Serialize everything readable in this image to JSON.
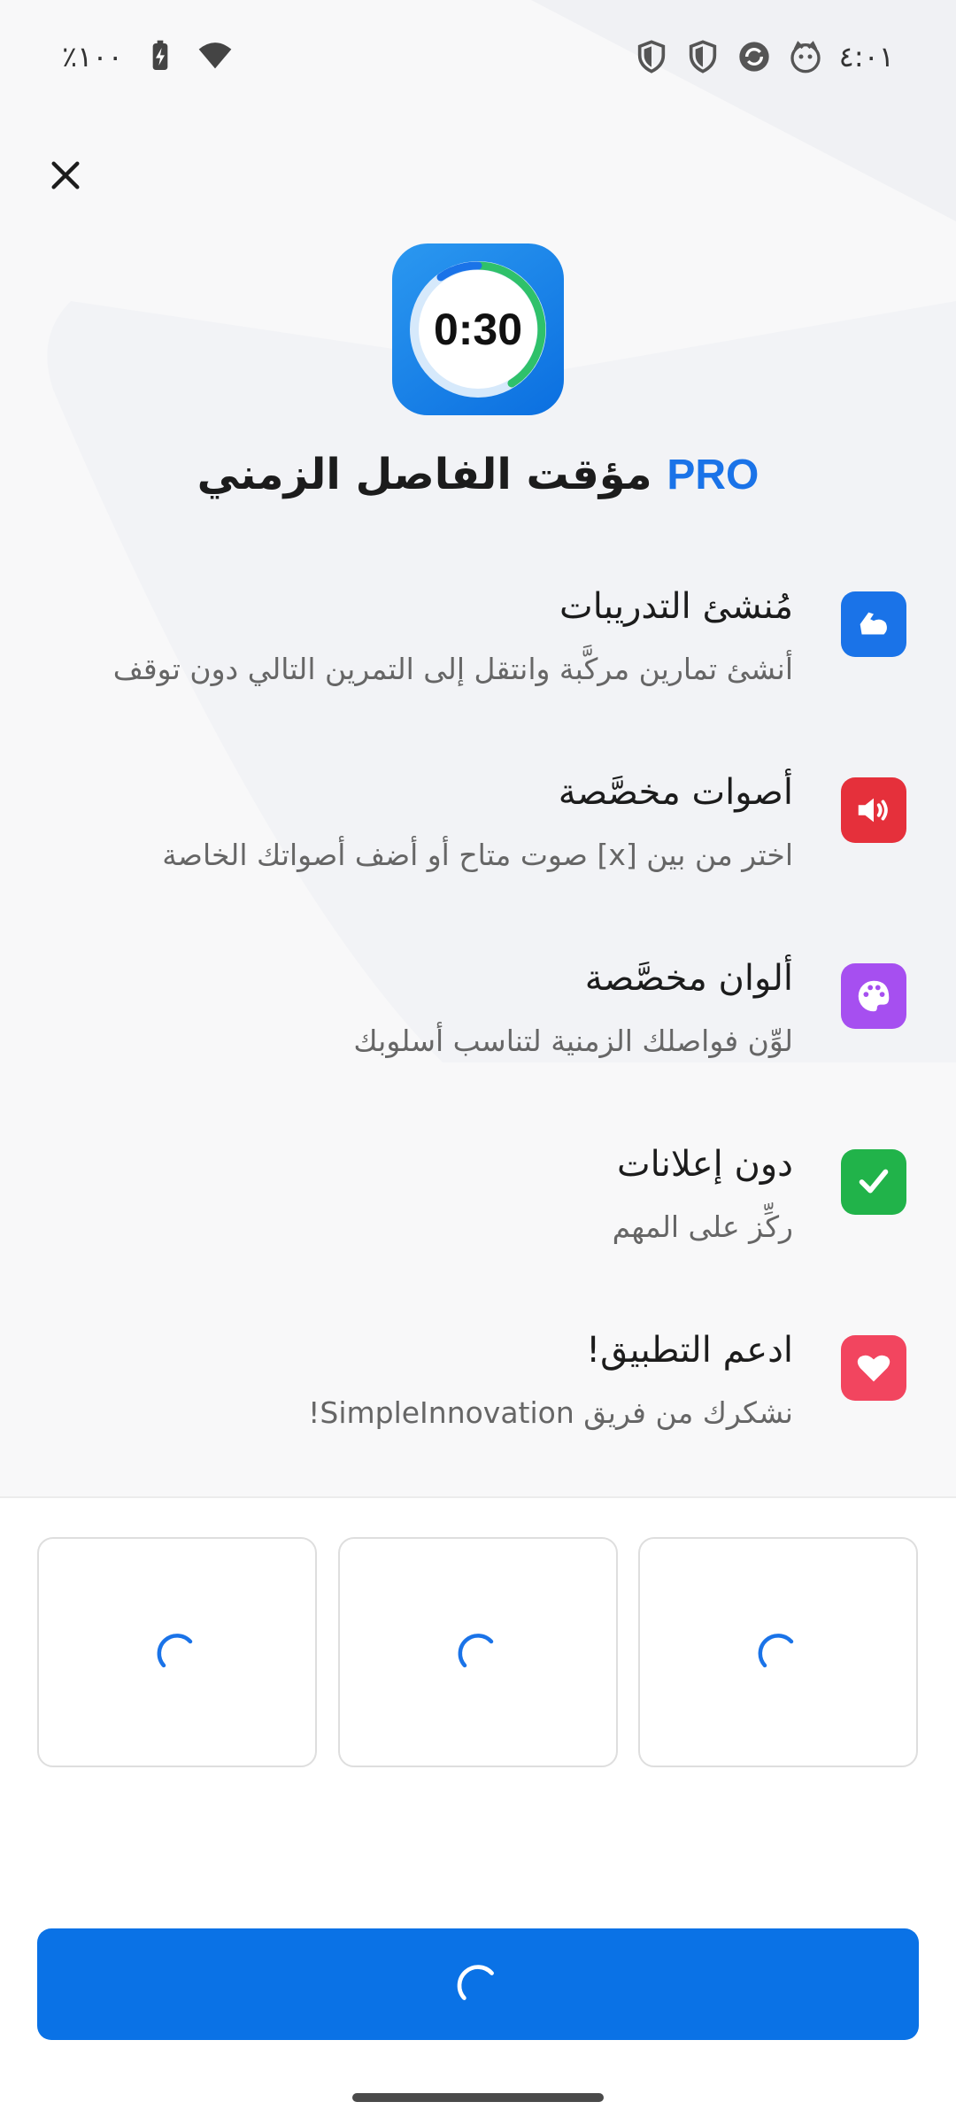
{
  "status_bar": {
    "time": "٤:٠١",
    "battery": "٪١٠٠",
    "icons": [
      "shield-icon",
      "shield-icon",
      "sync-icon",
      "cat-icon",
      "battery-charging-icon",
      "wifi-icon"
    ]
  },
  "header": {
    "close_icon": "close-icon",
    "logo_time": "0:30",
    "title": "مؤقت الفاصل الزمني",
    "title_badge": "PRO"
  },
  "features": [
    {
      "title": "مُنشئ التدريبات",
      "description": "أنشئ تمارين مركَّبة وانتقل إلى التمرين التالي دون توقف",
      "icon": "flexed-arm-icon",
      "color": "#1a73e8"
    },
    {
      "title": "أصوات مخصَّصة",
      "description": "اختر من بين [x] صوت متاح أو أضف أصواتك الخاصة",
      "icon": "speaker-icon",
      "color": "#e5303b"
    },
    {
      "title": "ألوان مخصَّصة",
      "description": "لوِّن فواصلك الزمنية لتناسب أسلوبك",
      "icon": "palette-icon",
      "color": "#a64ff0"
    },
    {
      "title": "دون إعلانات",
      "description": "ركِّز على المهم",
      "icon": "checkmark-icon",
      "color": "#21b34a"
    },
    {
      "title": "ادعم التطبيق!",
      "description": "نشكرك من فريق SimpleInnovation!",
      "icon": "heart-icon",
      "color": "#f2455f"
    }
  ],
  "purchase": {
    "plans_loading": 3,
    "button_state": "loading",
    "accent_color": "#0a72e6"
  }
}
